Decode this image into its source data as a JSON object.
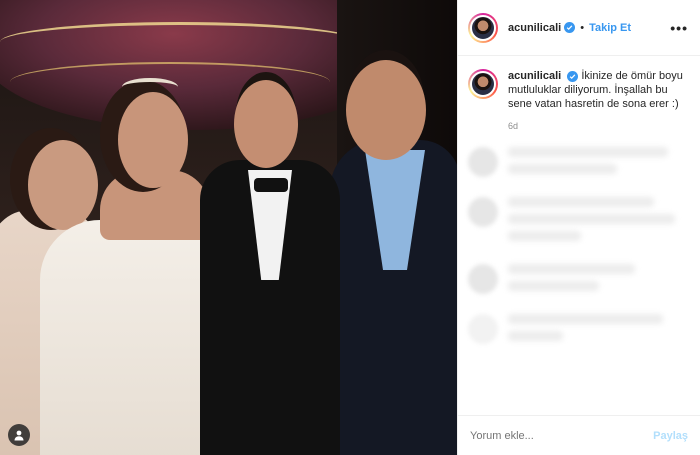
{
  "post": {
    "username": "acunilicali",
    "follow_label": "Takip Et",
    "separator": "•",
    "more_label": "•••",
    "caption": "İkinize de ömür boyu mutluluklar diliyorum. İnşallah bu sene vatan hasretin de sona erer :)",
    "time": "6d"
  },
  "comment_box": {
    "placeholder": "Yorum ekle...",
    "post_label": "Paylaş"
  },
  "colors": {
    "accent": "#3897f0",
    "post_disabled": "#b2dffc",
    "muted": "#8e8e8e"
  },
  "icons": {
    "tag": "user-tag-icon",
    "verified": "verified-badge-icon"
  }
}
